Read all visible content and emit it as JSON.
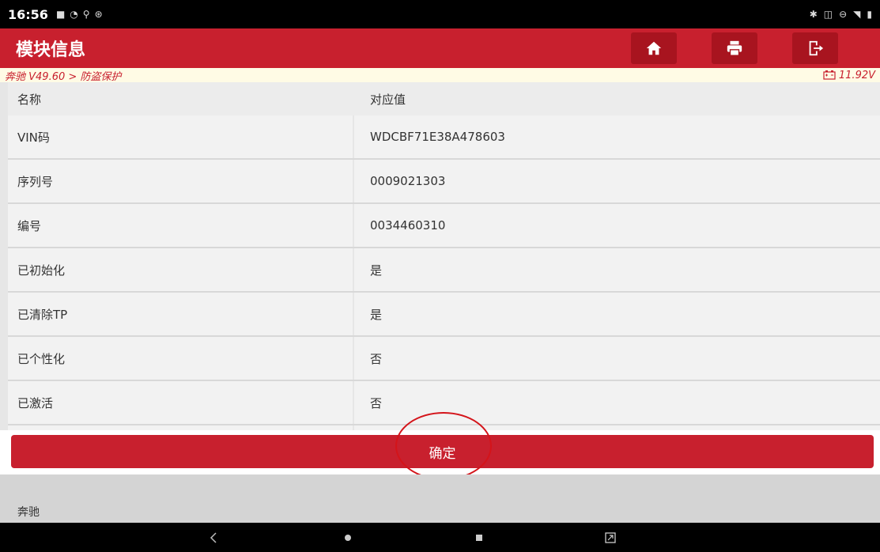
{
  "statusbar": {
    "time": "16:56",
    "left_icons": [
      "notification-icon",
      "wifi-icon",
      "data-icon",
      "accessibility-icon"
    ],
    "right_icons": [
      "bluetooth-icon",
      "vibrate-icon",
      "dnd-icon",
      "signal-icon",
      "battery-icon"
    ]
  },
  "titlebar": {
    "title": "模块信息",
    "buttons": [
      "home-icon",
      "print-icon",
      "exit-icon"
    ]
  },
  "breadcrumb": {
    "path": "奔驰 V49.60 > 防盗保护",
    "voltage": "11.92V"
  },
  "table": {
    "headers": [
      "名称",
      "对应值"
    ],
    "rows": [
      {
        "name": "VIN码",
        "value": "WDCBF71E38A478603"
      },
      {
        "name": "序列号",
        "value": "0009021303"
      },
      {
        "name": "编号",
        "value": "0034460310"
      },
      {
        "name": "已初始化",
        "value": "是"
      },
      {
        "name": "已清除TP",
        "value": "是"
      },
      {
        "name": "已个性化",
        "value": "否"
      },
      {
        "name": "已激活",
        "value": "否"
      }
    ]
  },
  "confirm_label": "确定",
  "footer": {
    "brand": "奔驰"
  },
  "colors": {
    "accent": "#c8202e",
    "dark_accent": "#a8141f",
    "highlight_circle": "#d4141a"
  }
}
